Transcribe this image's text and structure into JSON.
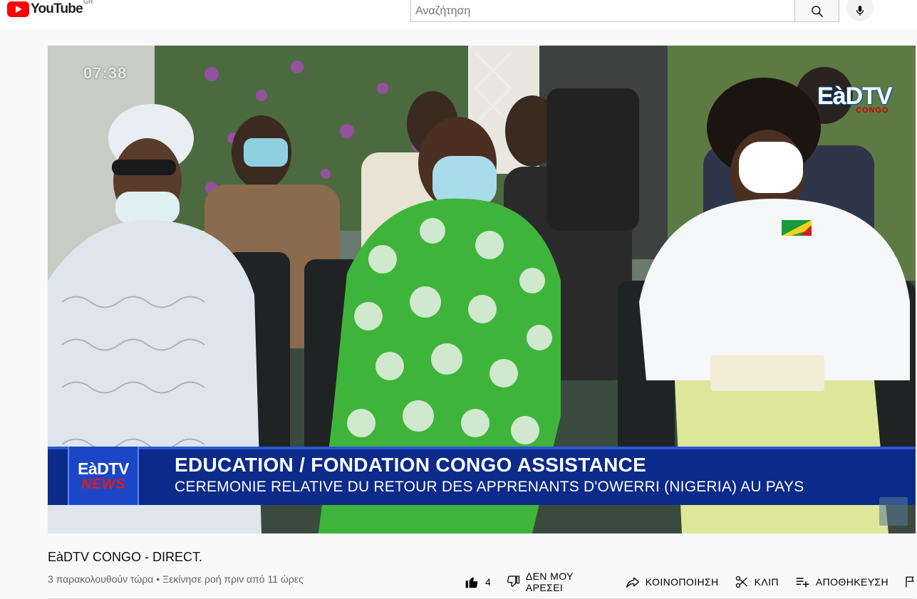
{
  "header": {
    "logo_text": "YouTube",
    "region": "GR",
    "search": {
      "placeholder": "Αναζήτηση",
      "value": ""
    }
  },
  "player": {
    "timestamp": "07:38",
    "channel_logo": "EàDTV",
    "channel_logo_sub": "CONGO",
    "lower_third": {
      "brand_top": "EàDTV",
      "brand_bottom": "NEWS",
      "headline": "EDUCATION / FONDATION CONGO ASSISTANCE",
      "subheadline": "CEREMONIE RELATIVE DU RETOUR DES APPRENANTS D'OWERRI (NIGERIA) AU PAYS"
    }
  },
  "video": {
    "title": "EàDTV CONGO - DIRECT.",
    "meta": "3 παρακολουθούν τώρα • Ξεκίνησε ροή πριν από 11 ώρες"
  },
  "actions": {
    "like_count": "4",
    "dislike_label": "ΔΕΝ ΜΟΥ ΑΡΕΣΕΙ",
    "share_label": "ΚΟΙΝΟΠΟΙΗΣΗ",
    "clip_label": "ΚΛΙΠ",
    "save_label": "ΑΠΟΘΗΚΕΥΣΗ"
  },
  "colors": {
    "brand_red": "#ff0000",
    "banner_blue": "#0b2a8a",
    "news_red": "#e01b1b"
  }
}
